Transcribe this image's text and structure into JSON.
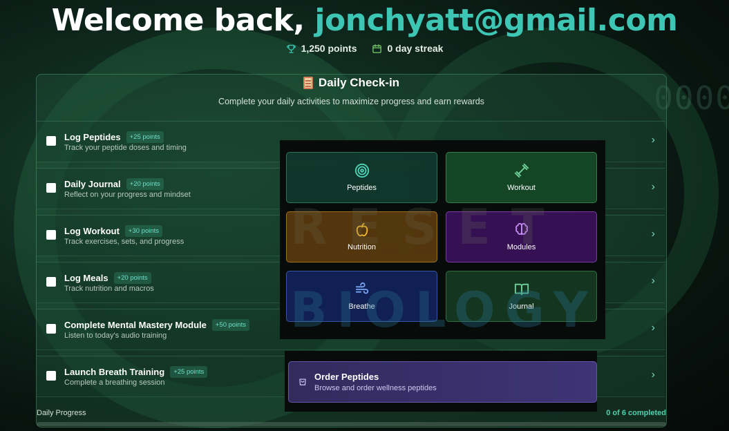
{
  "header": {
    "welcome_prefix": "Welcome back, ",
    "email": "jonchyatt@gmail.com",
    "points": "1,250 points",
    "streak": "0 day streak"
  },
  "checkin": {
    "title": "Daily Check-in",
    "subtitle": "Complete your daily activities to maximize progress and earn rewards",
    "items": [
      {
        "title": "Log Peptides",
        "points": "+25 points",
        "desc": "Track your peptide doses and timing",
        "checked": false
      },
      {
        "title": "Daily Journal",
        "points": "+20 points",
        "desc": "Reflect on your progress and mindset",
        "checked": false
      },
      {
        "title": "Log Workout",
        "points": "+30 points",
        "desc": "Track exercises, sets, and progress",
        "checked": false
      },
      {
        "title": "Log Meals",
        "points": "+20 points",
        "desc": "Track nutrition and macros",
        "checked": false
      },
      {
        "title": "Complete Mental Mastery Module",
        "points": "+50 points",
        "desc": "Listen to today's audio training",
        "checked": false
      },
      {
        "title": "Launch Breath Training",
        "points": "+25 points",
        "desc": "Complete a breathing session",
        "checked": false
      }
    ],
    "progress_label": "Daily Progress",
    "progress_count": "0 of 6 completed",
    "progress_fraction": 0
  },
  "quick_nav": {
    "peptides": "Peptides",
    "workout": "Workout",
    "nutrition": "Nutrition",
    "modules": "Modules",
    "breathe": "Breathe",
    "journal": "Journal"
  },
  "order": {
    "title": "Order Peptides",
    "desc": "Browse and order wellness peptides"
  },
  "icons": {
    "points": "trophy-icon",
    "streak": "calendar-icon",
    "peptides": "target-icon",
    "workout": "dumbbell-icon",
    "nutrition": "apple-icon",
    "modules": "brain-icon",
    "breathe": "wind-icon",
    "journal": "book-open-icon",
    "order": "shopping-bag-icon",
    "row_chevron": "chevron-right-icon"
  },
  "colors": {
    "accent_teal": "#3ec6b4",
    "points_badge": "#6fe0c8",
    "nutrition": "#f5b82e",
    "modules": "#c08af0",
    "breathe": "#7aa6f5",
    "journal": "#6fd39a",
    "order_bg": "#3e3476"
  }
}
